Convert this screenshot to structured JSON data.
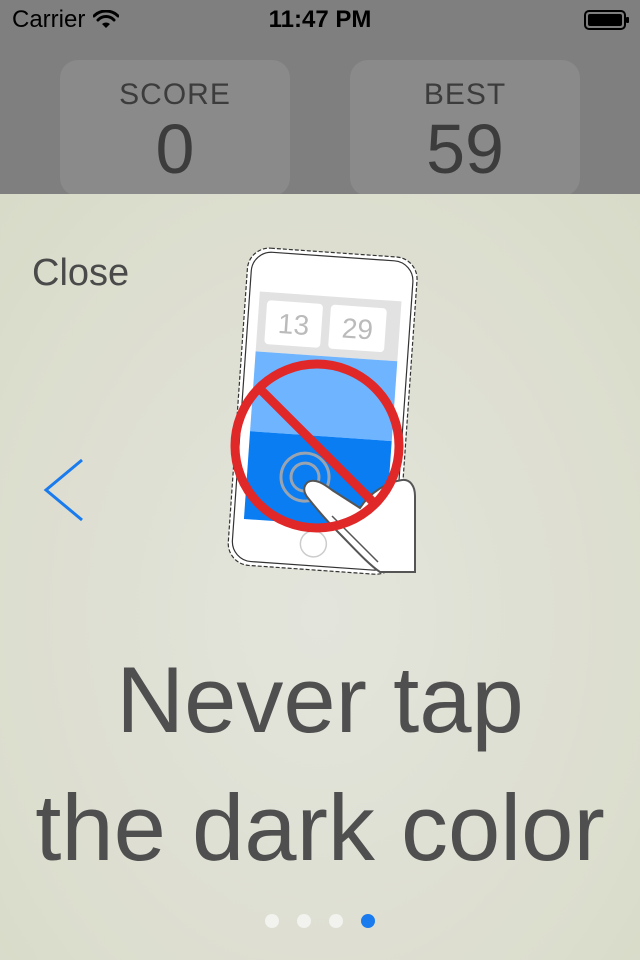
{
  "status_bar": {
    "carrier": "Carrier",
    "time": "11:47 PM",
    "icons": [
      "wifi-icon",
      "battery-icon"
    ]
  },
  "scoreboard": {
    "score_label": "SCORE",
    "score_value": "0",
    "best_label": "BEST",
    "best_value": "59"
  },
  "tutorial": {
    "close_label": "Close",
    "back_icon": "chevron-left-icon",
    "illustration": {
      "icon": "no-tap-dark-color-illustration",
      "phone_score": "13",
      "phone_best": "29"
    },
    "headline_line1": "Never tap",
    "headline_line2": "the dark color",
    "page_indicator": {
      "count": 4,
      "current": 4
    }
  },
  "colors": {
    "accent": "#1a7bef",
    "light_blue": "#6eb4ff",
    "dark_blue": "#0a7df2",
    "prohibition_red": "#e02828"
  }
}
